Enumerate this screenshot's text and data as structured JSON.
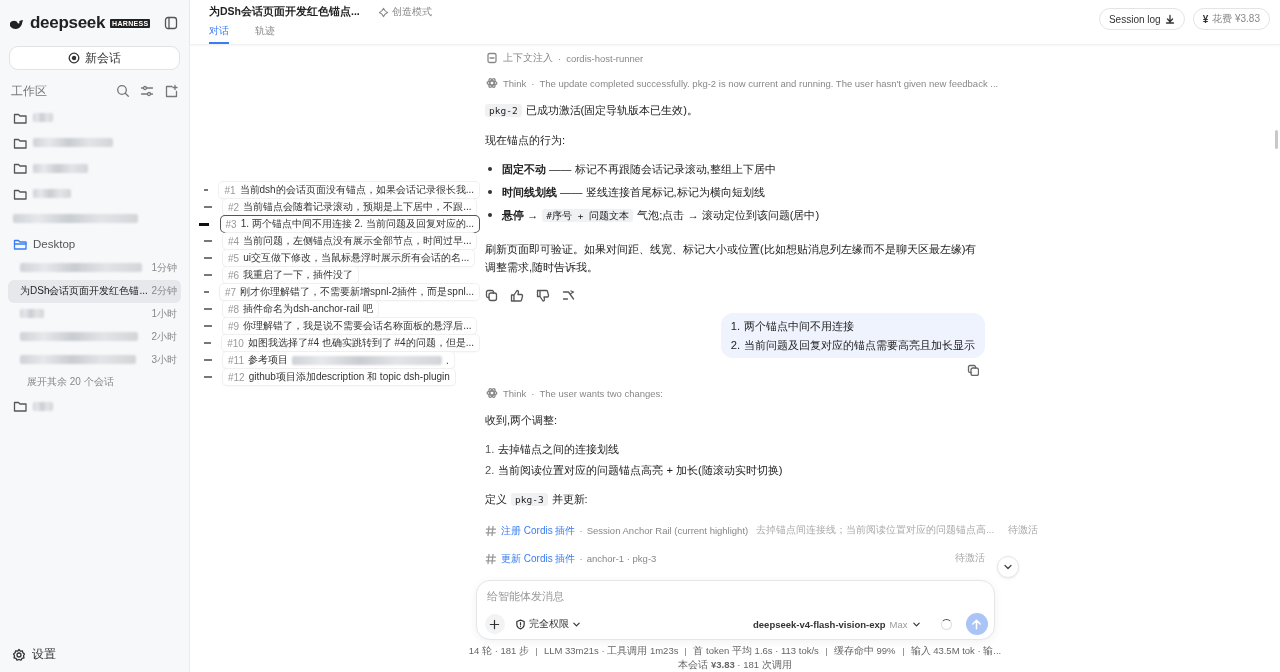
{
  "sidebar": {
    "brand": "deepseek",
    "badge": "HARNESS",
    "new_chat": "新会话",
    "workspace_label": "工作区",
    "folders": [
      {
        "kind": "folder",
        "redacted": true,
        "expanded": false
      },
      {
        "kind": "folder",
        "redacted": true,
        "expanded": false
      },
      {
        "kind": "folder",
        "redacted": true,
        "expanded": false
      },
      {
        "kind": "folder",
        "redacted": true,
        "expanded": false
      },
      {
        "kind": "blurred",
        "redacted": true
      },
      {
        "kind": "folder",
        "name": "Desktop",
        "expanded": true,
        "more": "展开其余 20 个会话",
        "sessions": [
          {
            "redacted": true,
            "time": "1分钟",
            "selected": false
          },
          {
            "title": "为DSh会话页面开发红色锚...",
            "time": "2分钟",
            "selected": true
          },
          {
            "redacted": true,
            "time": "1小时",
            "selected": false
          },
          {
            "redacted": true,
            "time": "2小时",
            "selected": false
          },
          {
            "redacted": true,
            "time": "3小时",
            "selected": false
          }
        ]
      },
      {
        "kind": "folder",
        "redacted": true,
        "expanded": false
      }
    ],
    "settings": "设置"
  },
  "header": {
    "title": "为DSh会话页面开发红色锚点...",
    "mode": "创造模式",
    "tabs": [
      {
        "label": "对话",
        "selected": true
      },
      {
        "label": "轨迹",
        "selected": false
      }
    ],
    "session_log": "Session log",
    "currency": "¥",
    "cost": "花费 ¥3.83"
  },
  "rail": [
    {
      "num": "#1",
      "text": "当前dsh的会话页面没有锚点，如果会话记录很长我...",
      "selected": false
    },
    {
      "num": "#2",
      "text": "当前锚点会随着记录滚动，预期是上下居中，不跟...",
      "selected": false
    },
    {
      "num": "#3",
      "text": "1. 两个锚点中间不用连接 2. 当前问题及回复对应的...",
      "selected": true
    },
    {
      "num": "#4",
      "text": "当前问题，左侧锚点没有展示全部节点，时间过早...",
      "selected": false
    },
    {
      "num": "#5",
      "text": "ui交互做下修改，当鼠标悬浮时展示所有会话的名...",
      "selected": false
    },
    {
      "num": "#6",
      "text": "我重启了一下，插件没了",
      "selected": false
    },
    {
      "num": "#7",
      "text": "刚才你理解错了，不需要新增spnl-2插件，而是spnl...",
      "selected": false
    },
    {
      "num": "#8",
      "text": "插件命名为dsh-anchor-rail 吧",
      "selected": false
    },
    {
      "num": "#9",
      "text": "你理解错了，我是说不需要会话名称面板的悬浮后...",
      "selected": false
    },
    {
      "num": "#10",
      "text": "如图我选择了#4 也确实跳转到了 #4的问题，但是...",
      "selected": false
    },
    {
      "num": "#11",
      "text": "参考项目",
      "redacted": true,
      "tail": ".",
      "selected": false
    },
    {
      "num": "#12",
      "text": "github项目添加description 和 topic dsh-plugin",
      "selected": false
    }
  ],
  "messages": [
    {
      "kind": "context",
      "label": "上下文注入",
      "separator": "·",
      "detail": "cordis-host-runner"
    },
    {
      "kind": "think",
      "label": "Think",
      "separator": "·",
      "text": "The update completed successfully. pkg-2 is now current and running. The user hasn't given new feedback ..."
    },
    {
      "kind": "paragraph",
      "segments": [
        {
          "kind": "code",
          "text": "pkg-2"
        },
        {
          "kind": "text",
          "text": "已成功激活(固定导轨版本已生效)。"
        }
      ]
    },
    {
      "kind": "paragraph",
      "segments": [
        {
          "kind": "text",
          "text": "现在锚点的行为:"
        }
      ]
    },
    {
      "kind": "bullets",
      "items": [
        {
          "segments": [
            {
              "kind": "text",
              "text": "**固定不动** —— 标记不再跟随会话记录滚动,整组上下居中"
            }
          ]
        },
        {
          "segments": [
            {
              "kind": "text",
              "text": "**时间线划线** —— 竖线连接首尾标记,标记为横向短划线"
            }
          ]
        },
        {
          "segments": [
            {
              "kind": "text",
              "text": "**悬停** →"
            },
            {
              "kind": "code",
              "text": "#序号 + 问题文本"
            },
            {
              "kind": "text",
              "text": "气泡;点击 → 滚动定位到该问题(居中)"
            }
          ]
        }
      ]
    },
    {
      "kind": "paragraph",
      "segments": [
        {
          "kind": "text",
          "text": "刷新页面即可验证。如果对间距、线宽、标记大小或位置(比如想贴消息列左缘而不是聊天区最左缘)有调整需求,随时告诉我。"
        }
      ]
    },
    {
      "kind": "actions"
    },
    {
      "kind": "user",
      "items": [
        {
          "number": "1.",
          "text": "两个锚点中间不用连接"
        },
        {
          "number": "2.",
          "text": "当前问题及回复对应的锚点需要高亮且加长显示"
        }
      ]
    },
    {
      "kind": "think",
      "label": "Think",
      "separator": "·",
      "text": "The user wants two changes:"
    },
    {
      "kind": "paragraph",
      "segments": [
        {
          "kind": "text",
          "text": "收到,两个调整:"
        }
      ]
    },
    {
      "kind": "numbered",
      "items": [
        {
          "number": "1.",
          "text": "去掉锚点之间的连接划线"
        },
        {
          "number": "2.",
          "text": "当前阅读位置对应的问题锚点高亮 + 加长(随滚动实时切换)"
        }
      ]
    },
    {
      "kind": "paragraph",
      "segments": [
        {
          "kind": "text",
          "text": "定义"
        },
        {
          "kind": "code",
          "text": "pkg-3"
        },
        {
          "kind": "text",
          "text": "并更新:"
        }
      ]
    },
    {
      "kind": "tool",
      "action": "注册 Cordis 插件",
      "separator": "·",
      "name": "Session Anchor Rail (current highlight)",
      "detail": "去掉锚点间连接线；当前阅读位置对应的问题锚点高...",
      "status": "待激活"
    },
    {
      "kind": "tool",
      "action": "更新 Cordis 插件",
      "separator": "·",
      "name": "anchor-1 · pkg-3",
      "status": "待激活"
    }
  ],
  "composer": {
    "placeholder": "给智能体发消息",
    "permission": "完全权限",
    "model": "deepseek-v4-flash-vision-exp",
    "effort": "Max",
    "busy": true,
    "send_disabled": true
  },
  "footer": {
    "stats": [
      "14 轮 · 181 步",
      "LLM 33m21s · 工具调用 1m23s",
      "首 token 平均 1.6s · 113 tok/s",
      "缓存命中 99%",
      "输入 43.5M tok · 输..."
    ],
    "session": "本会话 **¥3.83** · 181 次调用"
  }
}
